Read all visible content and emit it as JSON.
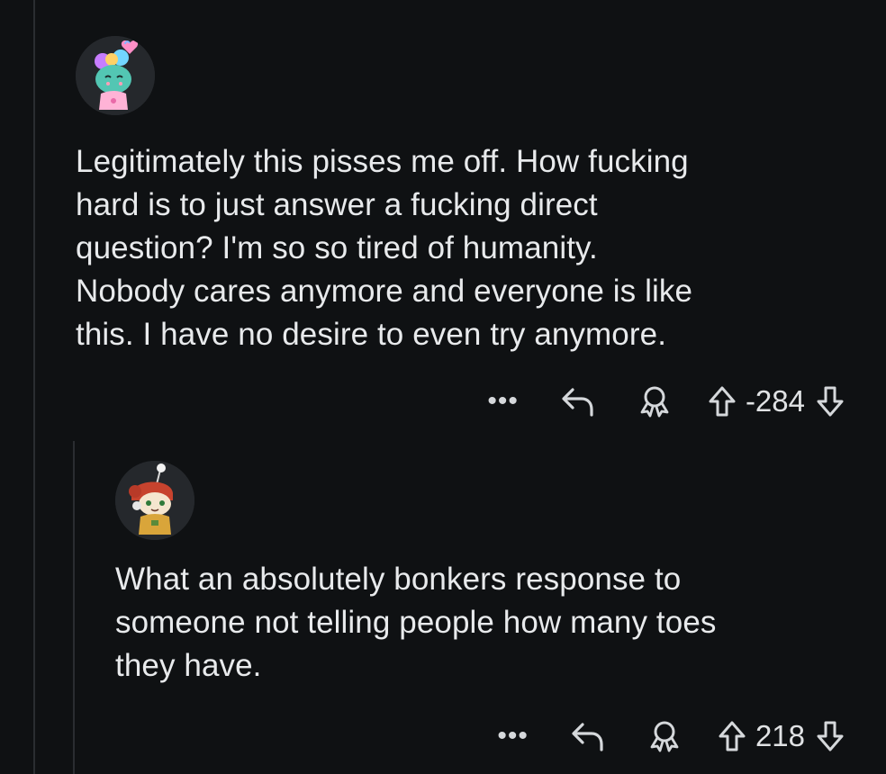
{
  "comments": [
    {
      "body": "Legitimately this pisses me off. How fucking\nhard is to just answer a fucking direct\nquestion? I'm so so tired of humanity.\nNobody cares anymore and everyone is like\nthis. I have no desire to even try anymore.",
      "score": "-284",
      "more_label": "•••"
    },
    {
      "body": "What an absolutely bonkers response to\nsomeone not telling people how many toes\nthey have.",
      "score": "218",
      "more_label": "•••"
    }
  ],
  "icons": {
    "more": "ellipsis-icon",
    "reply": "reply-arrow-icon",
    "award": "award-icon",
    "upvote": "upvote-arrow-icon",
    "downvote": "downvote-arrow-icon"
  },
  "colors": {
    "background": "#0f1113",
    "text": "#e8eaec",
    "thread_line": "#2a2d31"
  }
}
